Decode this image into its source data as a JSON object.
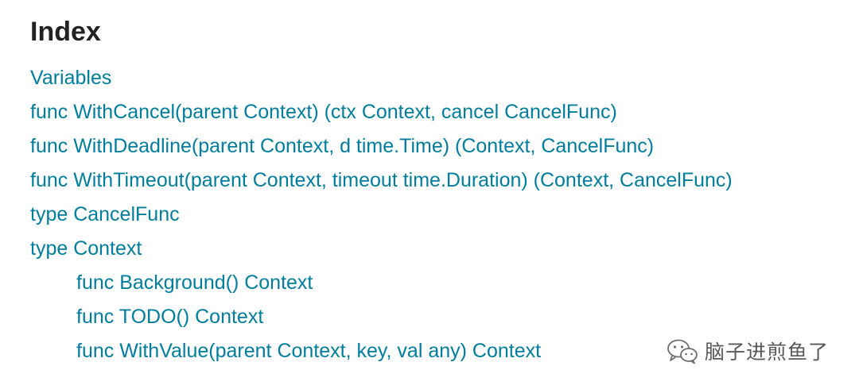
{
  "heading": "Index",
  "items": [
    {
      "text": "Variables"
    },
    {
      "text": "func WithCancel(parent Context) (ctx Context, cancel CancelFunc)"
    },
    {
      "text": "func WithDeadline(parent Context, d time.Time) (Context, CancelFunc)"
    },
    {
      "text": "func WithTimeout(parent Context, timeout time.Duration) (Context, CancelFunc)"
    },
    {
      "text": "type CancelFunc"
    },
    {
      "text": "type Context"
    },
    {
      "text": "func Background() Context"
    },
    {
      "text": "func TODO() Context"
    },
    {
      "text": "func WithValue(parent Context, key, val any) Context"
    }
  ],
  "watermark": {
    "icon": "wechat-icon",
    "text": "脑子进煎鱼了"
  },
  "colors": {
    "link": "#007d9c",
    "heading": "#202224"
  }
}
